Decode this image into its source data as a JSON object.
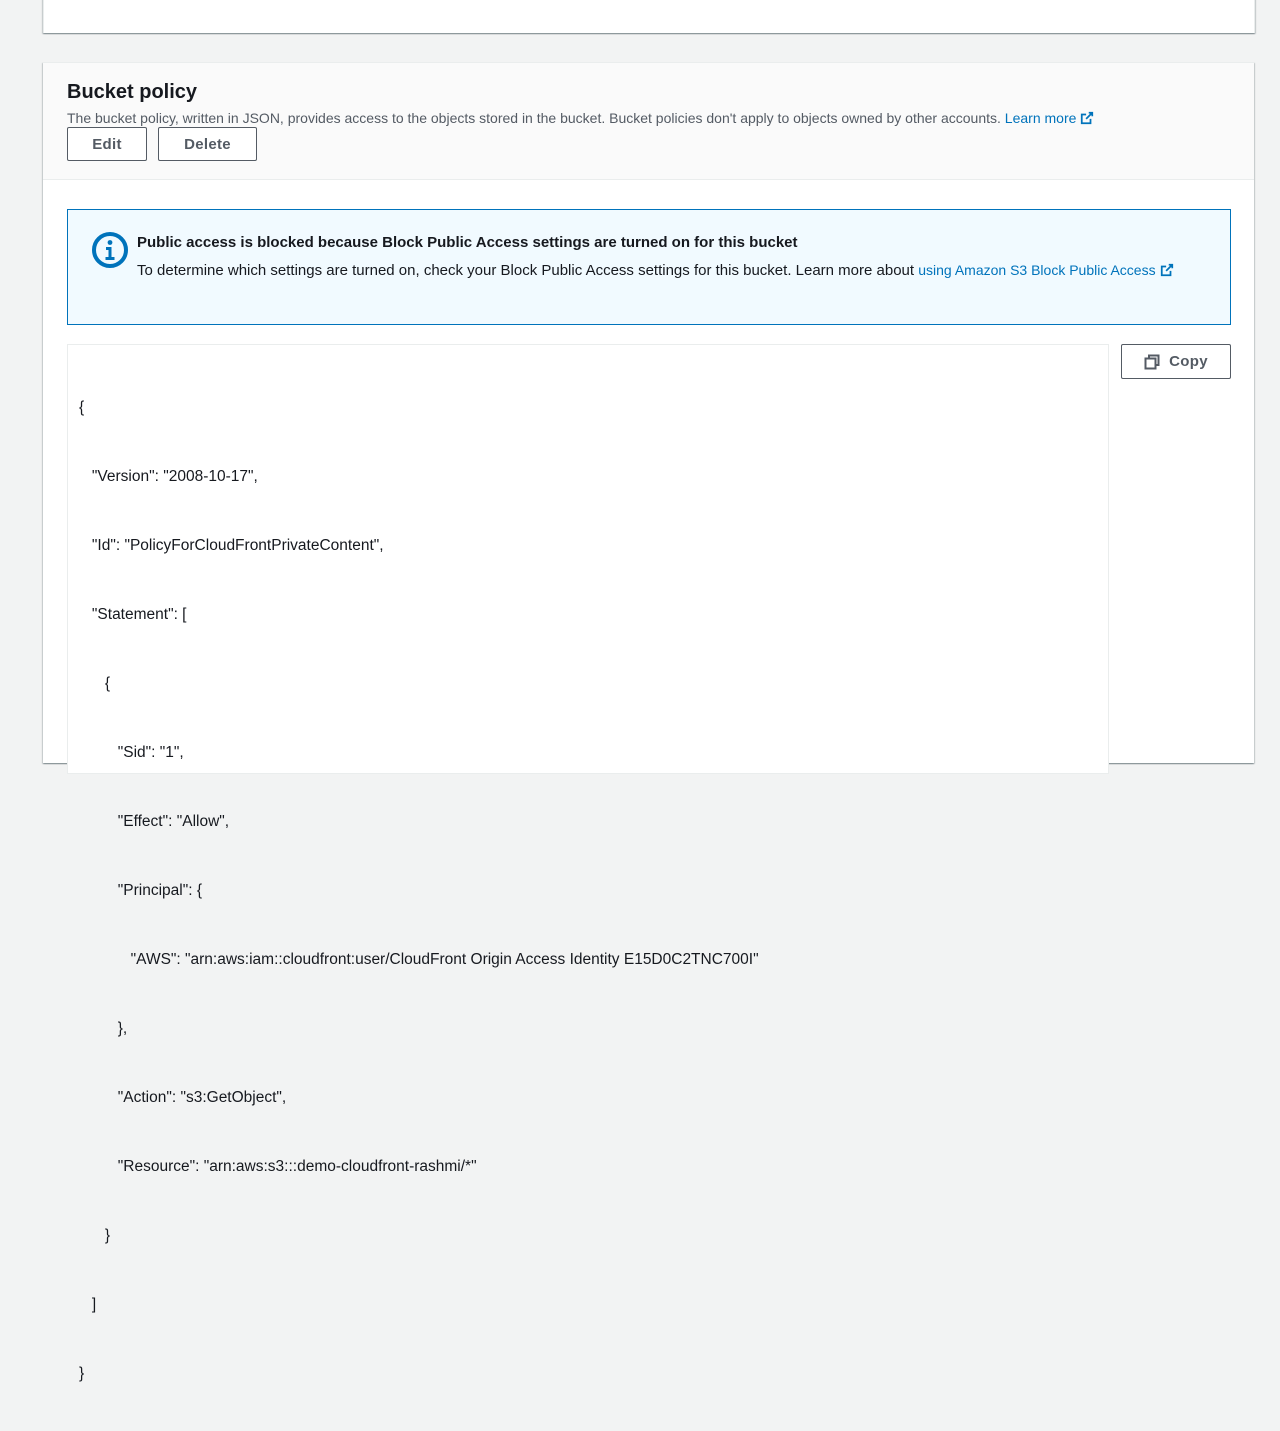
{
  "bucket_policy": {
    "title": "Bucket policy",
    "description": "The bucket policy, written in JSON, provides access to the objects stored in the bucket. Bucket policies don't apply to objects owned by other accounts.",
    "learn_more_label": "Learn more",
    "edit_label": "Edit",
    "delete_label": "Delete"
  },
  "alert": {
    "type": "info",
    "title": "Public access is blocked because Block Public Access settings are turned on for this bucket",
    "body": "To determine which settings are turned on, check your Block Public Access settings for this bucket. Learn more about",
    "link_label": "using Amazon S3 Block Public Access"
  },
  "policy_code": {
    "lines": [
      "{",
      "   \"Version\": \"2008-10-17\",",
      "   \"Id\": \"PolicyForCloudFrontPrivateContent\",",
      "   \"Statement\": [",
      "      {",
      "         \"Sid\": \"1\",",
      "         \"Effect\": \"Allow\",",
      "         \"Principal\": {",
      "            \"AWS\": \"arn:aws:iam::cloudfront:user/CloudFront Origin Access Identity E15D0C2TNC700I\"",
      "         },",
      "         \"Action\": \"s3:GetObject\",",
      "         \"Resource\": \"arn:aws:s3:::demo-cloudfront-rashmi/*\"",
      "      }",
      "   ]",
      "}"
    ],
    "copy_label": "Copy"
  },
  "colors": {
    "link": "#0073bb",
    "alert_border": "#0073bb",
    "alert_background": "#f1faff",
    "header_background": "#fafafa",
    "page_background": "#f2f3f3"
  },
  "icons": {
    "external_link": "external-link-icon",
    "info": "info-icon",
    "copy": "copy-icon"
  }
}
